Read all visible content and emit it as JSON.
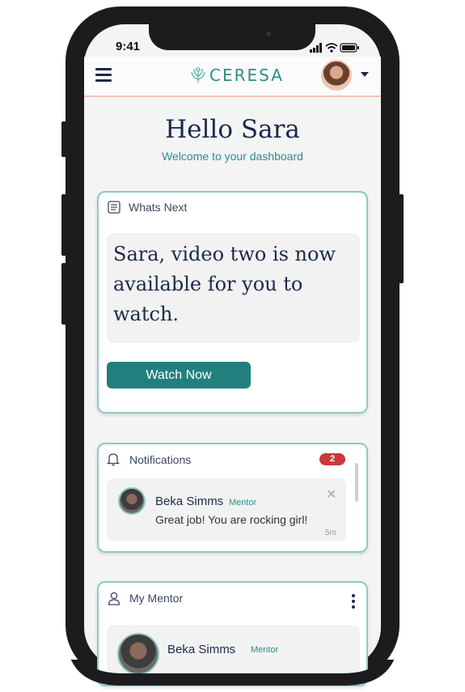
{
  "status_bar": {
    "time": "9:41"
  },
  "header": {
    "logo_text": "CERESA"
  },
  "greeting": {
    "title": "Hello Sara",
    "subtitle": "Welcome to your dashboard"
  },
  "whats_next": {
    "label": "Whats Next",
    "message": "Sara, video two is now available for you to watch.",
    "button_label": "Watch Now"
  },
  "notifications": {
    "label": "Notifications",
    "count": "2",
    "items": [
      {
        "name": "Beka Simms",
        "role": "Mentor",
        "message": "Great job! You are rocking girl!",
        "time": "5m",
        "close": "✕"
      }
    ]
  },
  "mentor": {
    "label": "My Mentor",
    "name": "Beka Simms",
    "role": "Mentor"
  },
  "colors": {
    "accent": "#2f8c8a",
    "button": "#237f7d",
    "badge": "#c93b3b",
    "navy": "#1b2a4a"
  },
  "icons": [
    "menu-icon",
    "ceresa-logo-icon",
    "chevron-down-icon",
    "list-icon",
    "bell-icon",
    "close-icon",
    "user-icon",
    "more-vertical-icon"
  ]
}
